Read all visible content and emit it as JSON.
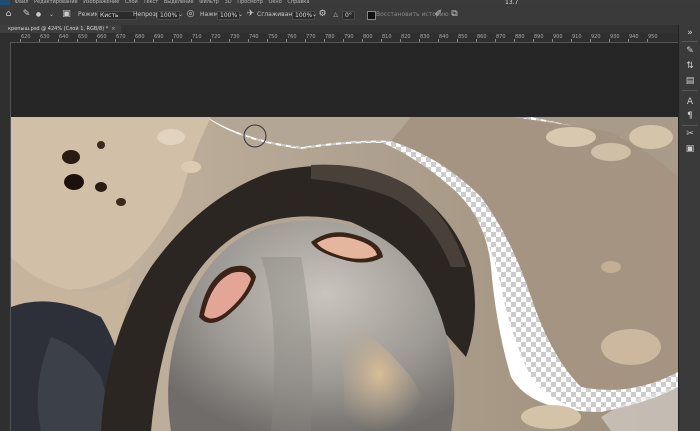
{
  "menubar": {
    "items": [
      "Файл",
      "Редактирование",
      "Изображение",
      "Слои",
      "Текст",
      "Выделение",
      "Фильтр",
      "3D",
      "Просмотр",
      "Окно",
      "Справка"
    ],
    "counter": "13.7"
  },
  "options": {
    "mode_label": "Режим:",
    "mode_value": "Кисть",
    "opacity_label": "Непрозр.:",
    "opacity_value": "100%",
    "flow_label": "Нажм.:",
    "flow_value": "100%",
    "smoothing_label": "Сглаживание:",
    "smoothing_value": "100%",
    "angle_value": "0°",
    "history_label": "Восстановить историю"
  },
  "document": {
    "tab_title": "крепыш.psd @ 424% (Слой 1, RGB/8) *",
    "close": "×"
  },
  "ruler": {
    "ticks": [
      "620",
      "630",
      "640",
      "650",
      "660",
      "670",
      "680",
      "690",
      "700",
      "710",
      "720",
      "730",
      "740",
      "750",
      "760",
      "770",
      "780",
      "790",
      "800",
      "810",
      "820",
      "830",
      "840",
      "850",
      "860",
      "870",
      "880",
      "890",
      "900",
      "910",
      "920",
      "930",
      "940",
      "950"
    ]
  },
  "colors": {
    "accent": "#1e4d7a",
    "canvas_bg": "#262626",
    "panel_bg": "#3a3a3a"
  },
  "right_panel_icons": [
    "expand-icon",
    "brush-settings-icon",
    "adjust-icon",
    "layers-icon",
    "character-icon",
    "paragraph-icon",
    "tools-icon",
    "swatch-icon"
  ]
}
